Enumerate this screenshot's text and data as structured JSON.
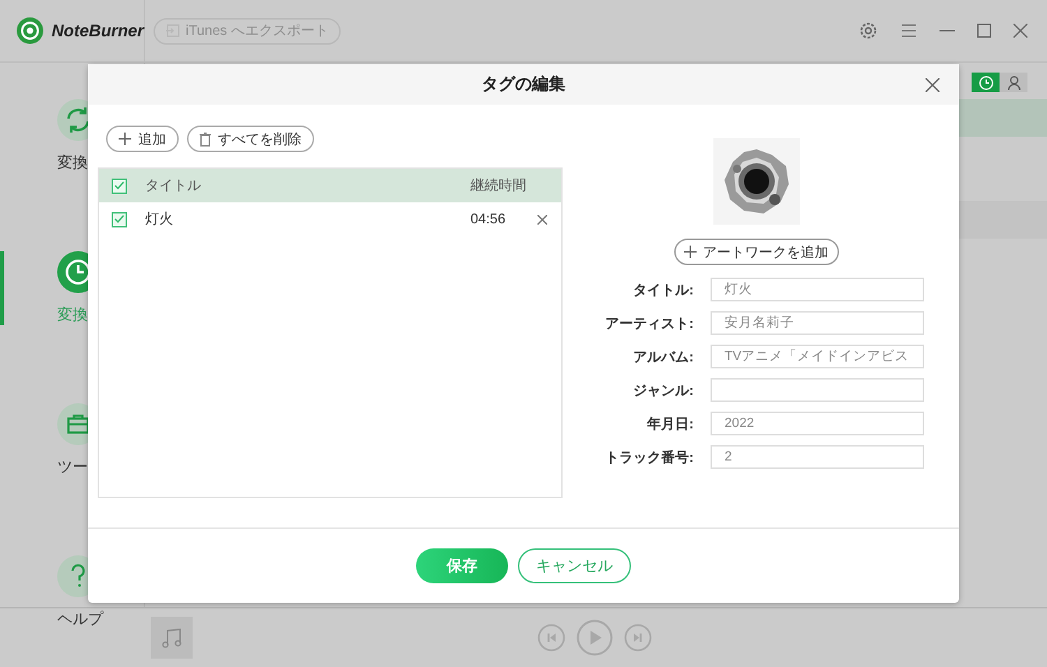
{
  "app": {
    "name": "NoteBurner",
    "export_button": "iTunes へエクスポート"
  },
  "sidebar": [
    {
      "kind": "sync",
      "label": "変換",
      "selected": false
    },
    {
      "kind": "clock",
      "label": "変換",
      "selected": true
    },
    {
      "kind": "toolbox",
      "label": "ツー",
      "selected": false
    },
    {
      "kind": "help",
      "label": "ヘルプ",
      "selected": false
    }
  ],
  "view_toggle": [
    {
      "kind": "clock",
      "selected": true
    },
    {
      "kind": "person",
      "selected": false
    }
  ],
  "dialog": {
    "title": "タグの編集",
    "toolbar": [
      {
        "kind": "add",
        "label": "追加"
      },
      {
        "kind": "delete",
        "label": "すべてを削除"
      }
    ],
    "table": {
      "header_checked": true,
      "columns": [
        "タイトル",
        "継続時間"
      ],
      "rows": [
        {
          "title": "灯火",
          "duration": "04:56",
          "checked": true
        }
      ]
    },
    "artwork_button": "アートワークを追加",
    "fields": [
      {
        "label": "タイトル:",
        "value": "灯火"
      },
      {
        "label": "アーティスト:",
        "value": "安月名莉子"
      },
      {
        "label": "アルバム:",
        "value": "TVアニメ「メイドインアビス"
      },
      {
        "label": "ジャンル:"
      },
      {
        "label": "年月日:",
        "value": "2022"
      },
      {
        "label": "トラック番号:",
        "value": "2"
      }
    ],
    "buttons": [
      {
        "kind": "primary",
        "label": "保存"
      },
      {
        "kind": "secondary",
        "label": "キャンセル"
      }
    ]
  }
}
